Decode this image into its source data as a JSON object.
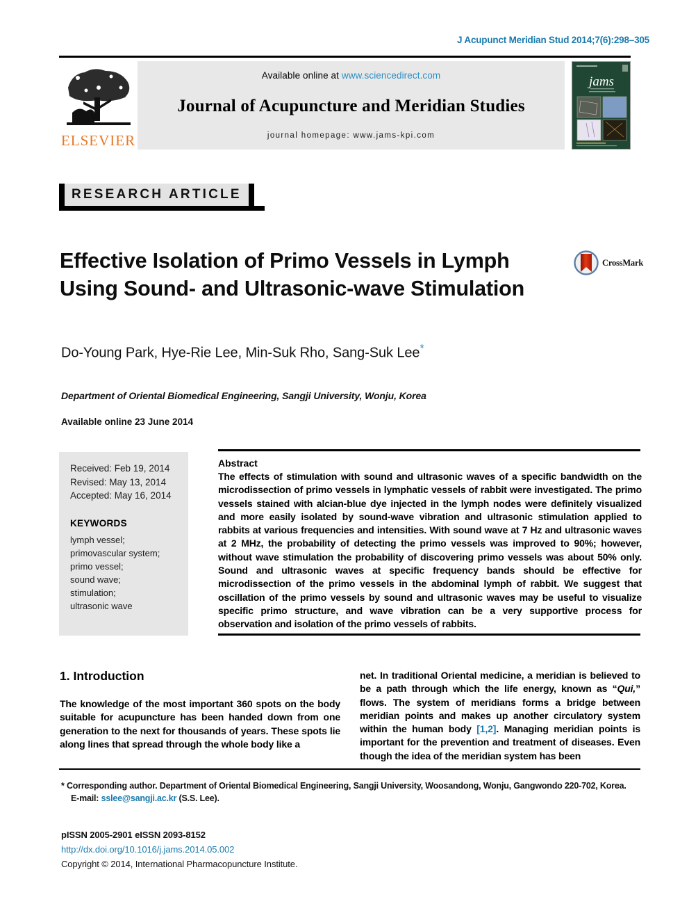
{
  "header": {
    "citation": "J Acupunct Meridian Stud 2014;7(6):298–305"
  },
  "masthead": {
    "publisher_name": "ELSEVIER",
    "available_prefix": "Available online at ",
    "available_link": "www.sciencedirect.com",
    "journal_title": "Journal of Acupuncture and Meridian Studies",
    "homepage": "journal homepage: www.jams-kpi.com",
    "cover_logo_text": "jams"
  },
  "article": {
    "type_badge": "RESEARCH ARTICLE",
    "title": "Effective Isolation of Primo Vessels in Lymph Using Sound- and Ultrasonic-wave Stimulation",
    "crossmark_label": "CrossMark",
    "authors": "Do-Young Park, Hye-Rie Lee, Min-Suk Rho, Sang-Suk Lee",
    "author_star": "*",
    "affiliation": "Department of Oriental Biomedical Engineering, Sangji University, Wonju, Korea",
    "available_online": "Available online 23 June 2014"
  },
  "sidebox": {
    "received": "Received: Feb 19, 2014",
    "revised": "Revised: May 13, 2014",
    "accepted": "Accepted: May 16, 2014",
    "keywords_heading": "KEYWORDS",
    "keywords": [
      "lymph vessel;",
      "primovascular system;",
      "primo vessel;",
      "sound wave;",
      "stimulation;",
      "ultrasonic wave"
    ]
  },
  "abstract": {
    "heading": "Abstract",
    "body": "The effects of stimulation with sound and ultrasonic waves of a specific bandwidth on the microdissection of primo vessels in lymphatic vessels of rabbit were investigated. The primo vessels stained with alcian-blue dye injected in the lymph nodes were definitely visualized and more easily isolated by sound-wave vibration and ultrasonic stimulation applied to rabbits at various frequencies and intensities. With sound wave at 7 Hz and ultrasonic waves at 2 MHz, the probability of detecting the primo vessels was improved to 90%; however, without wave stimulation the probability of discovering primo vessels was about 50% only. Sound and ultrasonic waves at specific frequency bands should be effective for microdissection of the primo vessels in the abdominal lymph of rabbit. We suggest that oscillation of the primo vessels by sound and ultrasonic waves may be useful to visualize specific primo structure, and wave vibration can be a very supportive process for observation and isolation of the primo vessels of rabbits."
  },
  "introduction": {
    "heading": "1. Introduction",
    "left_column": "The knowledge of the most important 360 spots on the body suitable for acupuncture has been handed down from one generation to the next for thousands of years. These spots lie along lines that spread through the whole body like a",
    "right_part1": "net. In traditional Oriental medicine, a meridian is believed to be a path through which the life energy, known as “",
    "right_qui": "Qui,",
    "right_part2": "” flows. The system of meridians forms a bridge between meridian points and makes up another circulatory system within the human body ",
    "right_ref": "[1,2]",
    "right_part3": ". Managing meridian points is important for the prevention and treatment of diseases. Even though the idea of the meridian system has been"
  },
  "footnote": {
    "star": "*",
    "corresponding": " Corresponding author. Department of Oriental Biomedical Engineering, Sangji University, Woosandong, Wonju, Gangwondo 220-702, Korea.",
    "email_label": "E-mail: ",
    "email": "sslee@sangji.ac.kr",
    "email_suffix": " (S.S. Lee)."
  },
  "issn": {
    "line1": "pISSN 2005-2901    eISSN 2093-8152",
    "doi": "http://dx.doi.org/10.1016/j.jams.2014.05.002",
    "copyright": "Copyright © 2014, International Pharmacopuncture Institute."
  },
  "colors": {
    "link": "#1a7aad",
    "sciencedirect_link": "#2a8fc4",
    "elsevier_orange": "#E87722",
    "masthead_bg": "#e8e8e8",
    "sidebox_bg": "#e6e6e6",
    "cover_green": "#1f4733"
  }
}
